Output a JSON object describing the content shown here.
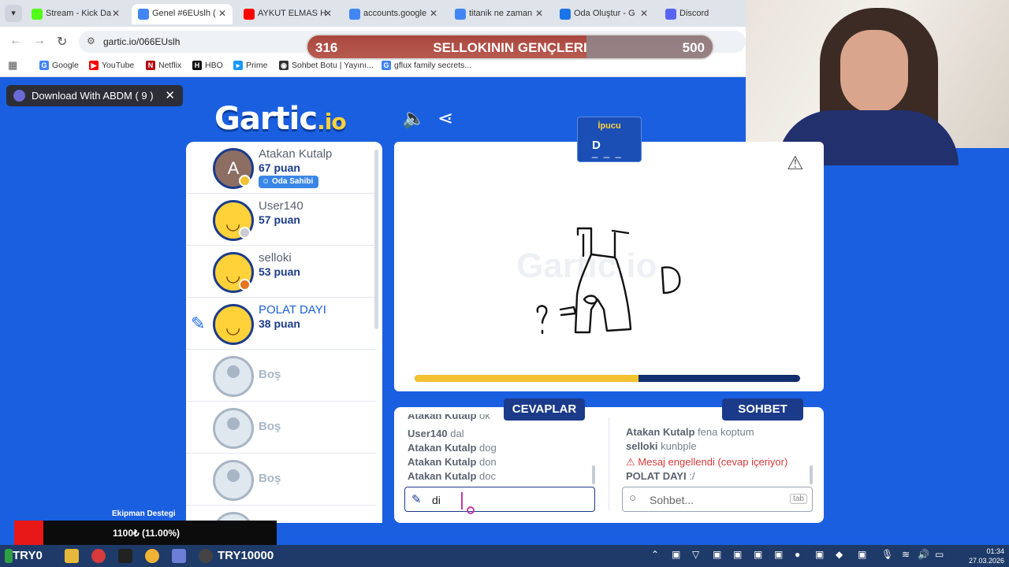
{
  "browser": {
    "tabs": [
      {
        "title": "Stream - Kick Da",
        "favicon_color": "#53fc18"
      },
      {
        "title": "Genel #6EUslh (",
        "favicon_color": "#4285f4",
        "active": true
      },
      {
        "title": "AYKUT ELMAS H",
        "favicon_color": "#ff0000"
      },
      {
        "title": "accounts.google",
        "favicon_color": "#4285f4"
      },
      {
        "title": "titanik ne zaman",
        "favicon_color": "#4285f4"
      },
      {
        "title": "Oda Oluştur - G",
        "favicon_color": "#1a73e8"
      },
      {
        "title": "Discord",
        "favicon_color": "#5865f2"
      }
    ],
    "url": "gartic.io/066EUslh",
    "bookmarks": [
      {
        "label": "Google",
        "icon": "google-icon"
      },
      {
        "label": "YouTube",
        "icon": "youtube-icon"
      },
      {
        "label": "Netflix",
        "icon": "netflix-icon"
      },
      {
        "label": "HBO",
        "icon": "hbo-icon"
      },
      {
        "label": "Prime",
        "icon": "prime-icon"
      },
      {
        "label": "Sohbet Botu | Yayını...",
        "icon": "bot-icon"
      },
      {
        "label": "gflux family secrets...",
        "icon": "google-icon"
      }
    ]
  },
  "scoreboard": {
    "left_score": "316",
    "team_name": "SELLOKININ GENÇLERI",
    "right_score": "500"
  },
  "download_bar": {
    "label": "Download With ABDM ( 9 )"
  },
  "game": {
    "logo_main": "Gartic",
    "logo_suffix": ".io",
    "hint": {
      "title": "İpucu",
      "letter": "D",
      "blanks": "_ _ _"
    },
    "timer_fraction": 0.58,
    "players": [
      {
        "name": "Atakan Kutalp",
        "score": "67 puan",
        "avatar": "letter",
        "letter": "A",
        "badge": "Oda Sahibi",
        "dot": "#f2c230"
      },
      {
        "name": "User140",
        "score": "57 puan",
        "avatar": "smile",
        "dot": "#c9ccd1"
      },
      {
        "name": "selloki",
        "score": "53 puan",
        "avatar": "smile",
        "dot": "#e8741c"
      },
      {
        "name": "POLAT DAYI",
        "score": "38 puan",
        "avatar": "smile",
        "drawing": true
      }
    ],
    "empty_slot_label": "Boş",
    "empty_slots": 3,
    "answers_tab": "CEVAPLAR",
    "chat_tab": "SOHBET",
    "answers": [
      {
        "user": "Atakan Kutalp",
        "text": "ok"
      },
      {
        "user": "User140",
        "text": "dal"
      },
      {
        "user": "Atakan Kutalp",
        "text": "dog"
      },
      {
        "user": "Atakan Kutalp",
        "text": "don"
      },
      {
        "user": "Atakan Kutalp",
        "text": "doc"
      }
    ],
    "chat": [
      {
        "user": "Atakan Kutalp",
        "text": "fena koptum"
      },
      {
        "user": "selloki",
        "text": "kunbple"
      },
      {
        "user": "",
        "text": "⚠ Mesaj engellendi (cevap içeriyor)",
        "error": true
      },
      {
        "user": "POLAT DAYI",
        "text": ":/"
      }
    ],
    "answer_input_value": "di",
    "chat_placeholder": "Sohbet...",
    "chat_key_hint": "tab"
  },
  "overlay": {
    "equipment_label": "Ekipman Destegi",
    "equipment_value": "1100₺ (11.00%)"
  },
  "taskbar": {
    "left_label": "TRY0",
    "mid_label": "TRY10000",
    "time": "01:34",
    "date": "27.03.2026"
  }
}
